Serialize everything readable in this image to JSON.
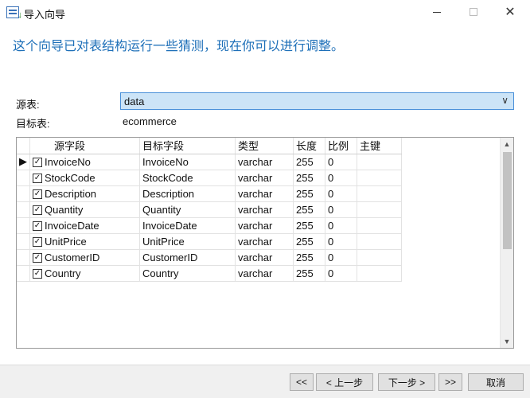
{
  "window": {
    "title": "导入向导",
    "minimize_glyph": "",
    "maximize_glyph": "",
    "close_glyph": "✕"
  },
  "header": {
    "text": "这个向导已对表结构运行一些猜测，现在你可以进行调整。"
  },
  "form": {
    "source_label": "源表:",
    "source_value": "data",
    "target_label": "目标表:",
    "target_value": "ecommerce"
  },
  "grid": {
    "columns": [
      "源字段",
      "目标字段",
      "类型",
      "长度",
      "比例",
      "主键"
    ],
    "rows": [
      {
        "checked": true,
        "source": "InvoiceNo",
        "target": "InvoiceNo",
        "type": "varchar",
        "length": "255",
        "scale": "0",
        "pk": "",
        "current": true
      },
      {
        "checked": true,
        "source": "StockCode",
        "target": "StockCode",
        "type": "varchar",
        "length": "255",
        "scale": "0",
        "pk": "",
        "current": false
      },
      {
        "checked": true,
        "source": "Description",
        "target": "Description",
        "type": "varchar",
        "length": "255",
        "scale": "0",
        "pk": "",
        "current": false
      },
      {
        "checked": true,
        "source": "Quantity",
        "target": "Quantity",
        "type": "varchar",
        "length": "255",
        "scale": "0",
        "pk": "",
        "current": false
      },
      {
        "checked": true,
        "source": "InvoiceDate",
        "target": "InvoiceDate",
        "type": "varchar",
        "length": "255",
        "scale": "0",
        "pk": "",
        "current": false
      },
      {
        "checked": true,
        "source": "UnitPrice",
        "target": "UnitPrice",
        "type": "varchar",
        "length": "255",
        "scale": "0",
        "pk": "",
        "current": false
      },
      {
        "checked": true,
        "source": "CustomerID",
        "target": "CustomerID",
        "type": "varchar",
        "length": "255",
        "scale": "0",
        "pk": "",
        "current": false
      },
      {
        "checked": true,
        "source": "Country",
        "target": "Country",
        "type": "varchar",
        "length": "255",
        "scale": "0",
        "pk": "",
        "current": false
      }
    ],
    "current_row_marker": "▶",
    "check_glyph": "✓"
  },
  "buttons": {
    "first": "<<",
    "prev": "< 上一步",
    "next": "下一步 >",
    "last": ">>",
    "cancel": "取消"
  },
  "icons": {
    "app": "import-wizard-icon",
    "combo_chevron": "chevron-down-icon",
    "scroll_up": "scroll-up-icon",
    "scroll_down": "scroll-down-icon"
  },
  "colors": {
    "header_text": "#1d6fb8",
    "combo_bg": "#cce4f7",
    "combo_border": "#4a90d9"
  }
}
